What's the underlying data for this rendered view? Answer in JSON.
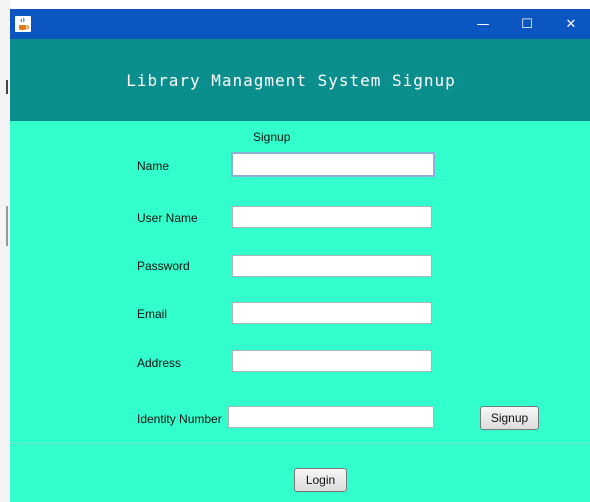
{
  "window": {
    "app_icon": "java-cup-icon",
    "controls": {
      "minimize": "—",
      "maximize": "☐",
      "close": "✕"
    }
  },
  "header": {
    "title": "Library Managment System Signup"
  },
  "form": {
    "title": "Signup",
    "fields": [
      {
        "label": "Name",
        "value": ""
      },
      {
        "label": "User Name",
        "value": ""
      },
      {
        "label": "Password",
        "value": ""
      },
      {
        "label": "Email",
        "value": ""
      },
      {
        "label": "Address",
        "value": ""
      },
      {
        "label": "Identity Number",
        "value": ""
      }
    ],
    "signup_button": "Signup",
    "login_button": "Login"
  },
  "colors": {
    "titlebar": "#0b56c0",
    "header": "#0b8f8e",
    "form_background": "#33ffcc"
  }
}
